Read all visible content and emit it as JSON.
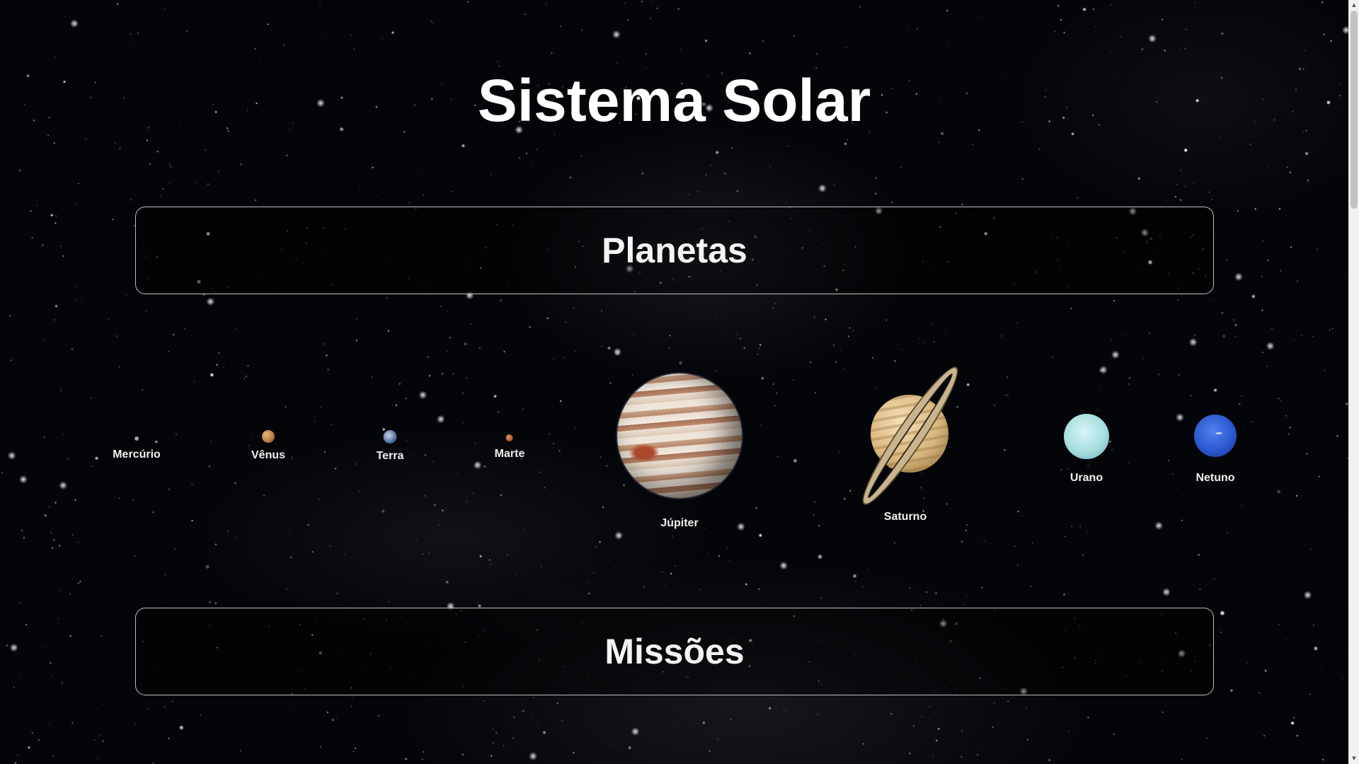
{
  "page": {
    "title": "Sistema Solar"
  },
  "sections": {
    "planets_title": "Planetas",
    "missions_title": "Missões"
  },
  "planets": [
    {
      "name": "Mercúrio",
      "color": "#8a8aa8"
    },
    {
      "name": "Vênus",
      "color": "#c48a45"
    },
    {
      "name": "Terra",
      "color": "#6a84b4"
    },
    {
      "name": "Marte",
      "color": "#c06a35"
    },
    {
      "name": "Júpiter",
      "color": "#d7b79a"
    },
    {
      "name": "Saturno",
      "color": "#d8b57c"
    },
    {
      "name": "Urano",
      "color": "#a6dee0"
    },
    {
      "name": "Netuno",
      "color": "#2a55cc"
    }
  ],
  "theme": {
    "background": "#040508",
    "text": "#ffffff",
    "section_border": "#ffffff"
  }
}
